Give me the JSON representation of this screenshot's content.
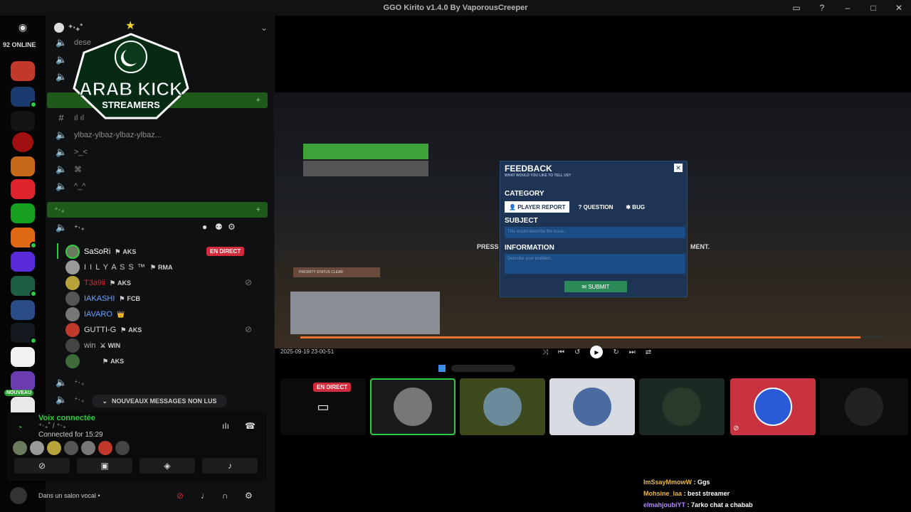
{
  "window": {
    "title": "GGO Kirito v1.4.0 By VaporousCreeper"
  },
  "rail": {
    "online_count": "92 ONLINE",
    "nouveau_badge": "NOUVEAU"
  },
  "server": {
    "name": "⁺‧₊˚",
    "logo_text_1": "ARAB KICK",
    "logo_text_2": "STREAMERS"
  },
  "channels": {
    "vc1": "dese",
    "vc2": "",
    "vc_text1": "ıl ıl",
    "vc_ylbaz": "ylbaz-ylbaz-ylbaz-ylbaz...",
    "vc_face": ">_<",
    "vc_x": "⌘",
    "vc_caret": "^_^",
    "green_cat_1": "",
    "green_cat_2": "⁺‧₊",
    "active_vc": "⁺‧₊"
  },
  "members": [
    {
      "name": "SaSoRi",
      "tag": "AKS",
      "live": "EN DIRECT"
    },
    {
      "name": "I I L Y A S S ™",
      "tag": "RMA"
    },
    {
      "name": "T3a9ii",
      "tag": "AKS"
    },
    {
      "name": "IAKASHI",
      "tag": "FCB"
    },
    {
      "name": "IAVARO",
      "tag": "👑"
    },
    {
      "name": "GUTTI-G",
      "tag": "AKS"
    },
    {
      "name": "win",
      "tag": "WIN"
    },
    {
      "name": "",
      "tag": "AKS"
    }
  ],
  "new_messages": "NOUVEAUX MESSAGES NON LUS",
  "voice": {
    "status": "Voix connectée",
    "channel": "⁺‧₊˚ / ⁺‧₊",
    "connected": "Connected for 15:29"
  },
  "user_bar": {
    "status": "Dans un salon vocal •"
  },
  "stream": {
    "live": "EN DIRECT",
    "timestamp": "2025-09-19 23-00-51",
    "feedback": {
      "title": "FEEDBACK",
      "subtitle": "WHAT WOULD YOU LIKE TO TELL US?",
      "category": "CATEGORY",
      "tabs": [
        "PLAYER REPORT",
        "QUESTION",
        "BUG"
      ],
      "subject": "SUBJECT",
      "subject_placeholder": "This would describe the issue...",
      "information": "INFORMATION",
      "information_placeholder": "Describe your problem...",
      "submit": "SUBMIT"
    },
    "press_text": "PRESS",
    "ment_text": "MENT.",
    "hud_label": "PRIORITY STATUS CLEAR"
  },
  "chat": [
    {
      "user": "ImSsayMmowW",
      "text": ": Ggs"
    },
    {
      "user": "Mohsine_laa",
      "text": ": best streamer"
    },
    {
      "user": "elmahjoubiYT",
      "text": ": 7arko chat a chabab"
    }
  ],
  "colors": {
    "accent_green": "#1f5a1a",
    "live_red": "#d12b3c",
    "feedback_blue": "#1d3455"
  }
}
